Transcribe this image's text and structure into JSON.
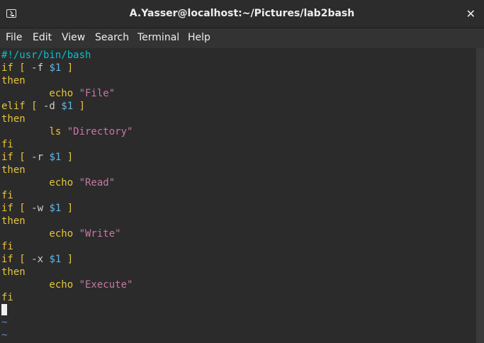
{
  "window": {
    "title": "A.Yasser@localhost:~/Pictures/lab2bash",
    "close_glyph": "✕"
  },
  "menu": {
    "items": [
      "File",
      "Edit",
      "View",
      "Search",
      "Terminal",
      "Help"
    ]
  },
  "terminal": {
    "lines": [
      "#!/usr/bin/bash",
      "if [ -f $1 ]",
      "then",
      "        echo \"File\"",
      "elif [ -d $1 ]",
      "then",
      "        ls \"Directory\"",
      "fi",
      "if [ -r $1 ]",
      "then",
      "        echo \"Read\"",
      "fi",
      "if [ -w $1 ]",
      "then",
      "        echo \"Write\"",
      "fi",
      "if [ -x $1 ]",
      "then",
      "        echo \"Execute\"",
      "fi"
    ],
    "tildes": [
      "~",
      "~"
    ]
  },
  "colors": {
    "shebang": "#06c0c8",
    "keyword": "#e9c33b",
    "variable": "#62b7e8",
    "string": "#c678a5",
    "tilde": "#5f88c8"
  }
}
